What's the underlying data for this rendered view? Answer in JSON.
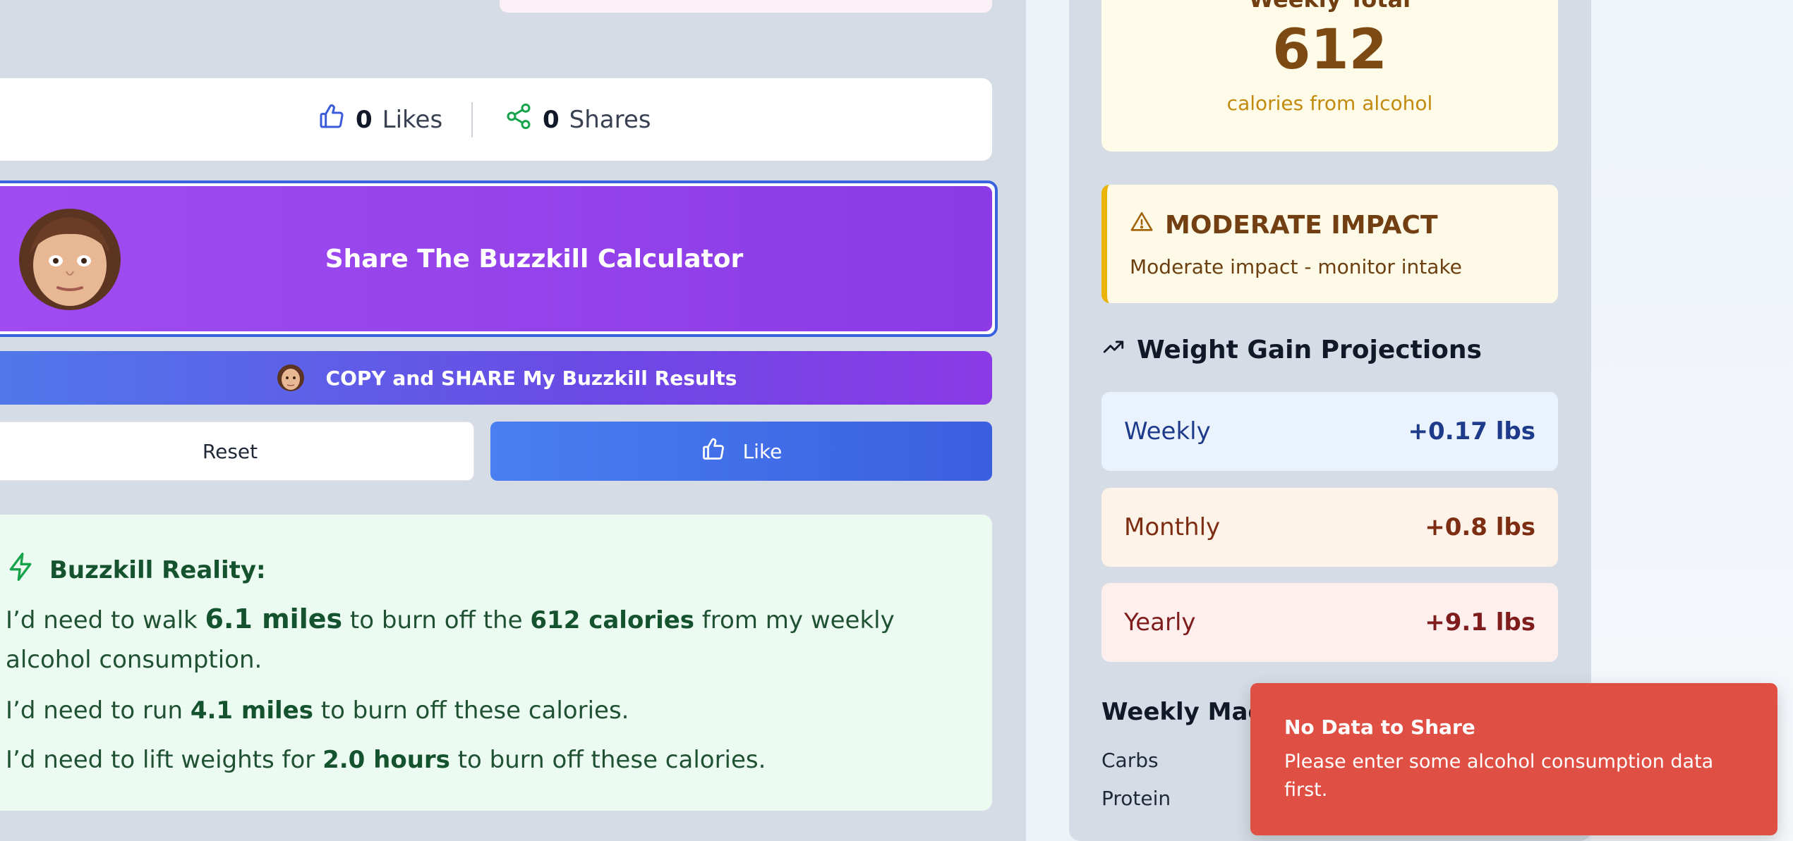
{
  "stats": {
    "likes_count": "0",
    "likes_label": "Likes",
    "shares_count": "0",
    "shares_label": "Shares"
  },
  "share_banner": {
    "title": "Share The Buzzkill Calculator"
  },
  "copy_share_button": {
    "label": "COPY and SHARE My Buzzkill Results"
  },
  "actions": {
    "reset_label": "Reset",
    "like_label": "Like"
  },
  "reality": {
    "title": "Buzzkill Reality:",
    "walk": {
      "prefix": "I’d need to walk ",
      "distance": "6.1 miles",
      "middle": " to burn off the ",
      "calories": "612 calories",
      "suffix": " from my weekly alcohol consumption."
    },
    "run": {
      "prefix": "I’d need to run ",
      "distance": "4.1 miles",
      "suffix": " to burn off these calories."
    },
    "lift": {
      "prefix": "I’d need to lift weights for ",
      "duration": "2.0 hours",
      "suffix": " to burn off these calories."
    }
  },
  "weekly_total": {
    "label": "Weekly Total",
    "value": "612",
    "sub": "calories from alcohol"
  },
  "impact": {
    "title": "MODERATE IMPACT",
    "description": "Moderate impact - monitor intake"
  },
  "projections": {
    "title": "Weight Gain Projections",
    "rows": [
      {
        "label": "Weekly",
        "value": "+0.17 lbs"
      },
      {
        "label": "Monthly",
        "value": "+0.8 lbs"
      },
      {
        "label": "Yearly",
        "value": "+9.1 lbs"
      }
    ]
  },
  "macros": {
    "title": "Weekly Macr",
    "items": [
      "Carbs",
      "Protein"
    ]
  },
  "toast": {
    "title": "No Data to Share",
    "message": "Please enter some alcohol consumption data first."
  },
  "colors": {
    "accent_purple": "#8b3ae6",
    "accent_blue": "#3b63e0",
    "toast_red": "#e04f43",
    "impact_yellow": "#eab308"
  }
}
